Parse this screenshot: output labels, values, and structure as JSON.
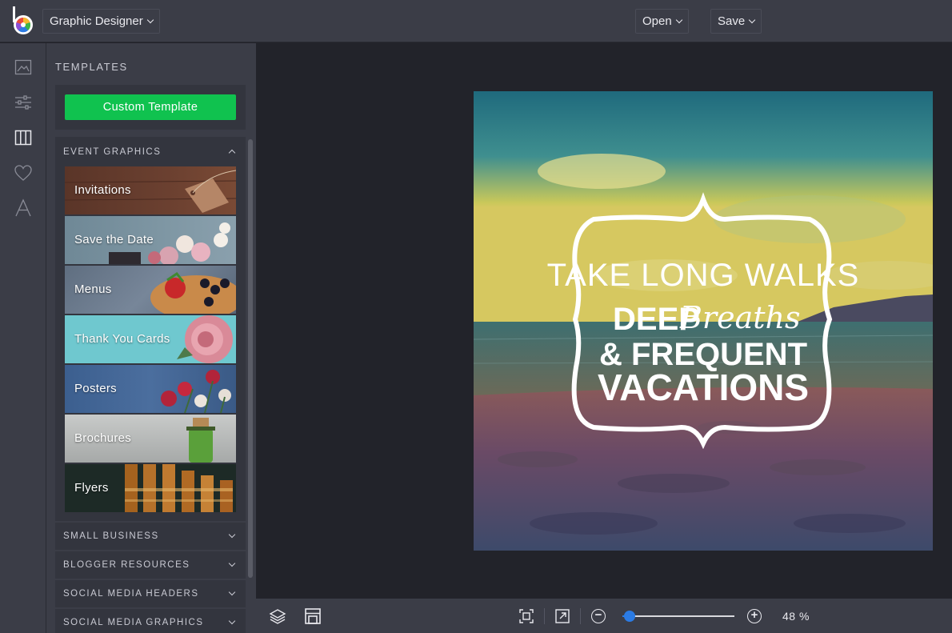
{
  "app": {
    "name": "Graphic Designer",
    "menus": {
      "open": "Open",
      "save": "Save"
    }
  },
  "rail": {
    "icons": [
      "image-icon",
      "sliders-icon",
      "templates-icon",
      "heart-icon",
      "text-icon"
    ],
    "active": "templates-icon"
  },
  "panel": {
    "title": "TEMPLATES",
    "custom_button": "Custom Template",
    "sections": [
      {
        "label": "EVENT GRAPHICS",
        "expanded": true,
        "items": [
          "Invitations",
          "Save the Date",
          "Menus",
          "Thank You Cards",
          "Posters",
          "Brochures",
          "Flyers"
        ]
      },
      {
        "label": "SMALL BUSINESS",
        "expanded": false
      },
      {
        "label": "BLOGGER RESOURCES",
        "expanded": false
      },
      {
        "label": "SOCIAL MEDIA HEADERS",
        "expanded": false
      },
      {
        "label": "SOCIAL MEDIA GRAPHICS",
        "expanded": false
      }
    ]
  },
  "artwork": {
    "line1": "TAKE LONG WALKS",
    "line2a": "DEEP",
    "line2b": "Breaths",
    "line3": "& FREQUENT",
    "line4": "VACATIONS"
  },
  "bottom": {
    "zoom_minus": "−",
    "zoom_plus": "+",
    "zoom_value": "48",
    "zoom_percent": 48,
    "zoom_text": "48 %"
  },
  "colors": {
    "accent_green": "#10c24f",
    "slider_blue": "#2b7be4"
  }
}
